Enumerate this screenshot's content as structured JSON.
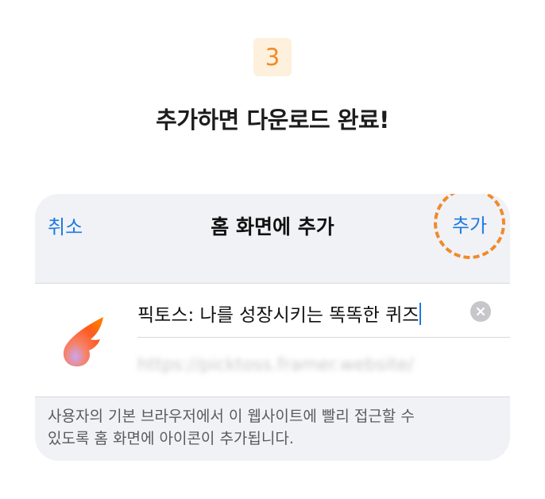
{
  "step": {
    "number": "3"
  },
  "headline": "추가하면 다운로드 완료!",
  "sheet": {
    "cancel_label": "취소",
    "title": "홈 화면에 추가",
    "add_label": "추가",
    "app_name_value": "픽토스: 나를 성장시키는 똑똑한 퀴즈",
    "url_value": "https://picktoss.framer.website/",
    "app_icon": "flame-logo-icon",
    "clear_icon": "clear-x-icon",
    "footnote_line1": "사용자의 기본 브라우저에서 이 웹사이트에 빨리 접근할 수",
    "footnote_line2": "있도록 홈 화면에 아이콘이 추가됩니다."
  },
  "colors": {
    "accent_orange": "#f08a2a",
    "ios_blue": "#1f7ae0",
    "sheet_bg": "#f1f2f6"
  }
}
